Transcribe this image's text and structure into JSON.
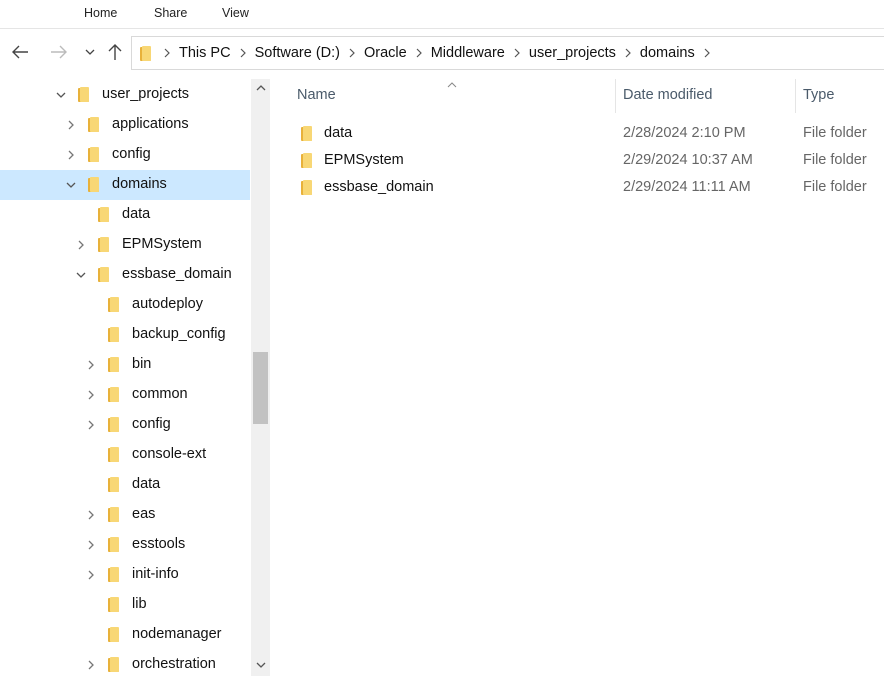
{
  "ribbon": {
    "tabs": [
      "Home",
      "Share",
      "View"
    ]
  },
  "nav": {
    "breadcrumb": [
      "This PC",
      "Software (D:)",
      "Oracle",
      "Middleware",
      "user_projects",
      "domains"
    ]
  },
  "tree": {
    "items": [
      {
        "label": "user_projects",
        "chevron": "down"
      },
      {
        "label": "applications",
        "chevron": "right"
      },
      {
        "label": "config",
        "chevron": "right"
      },
      {
        "label": "domains",
        "chevron": "down",
        "selected": true
      },
      {
        "label": "data",
        "chevron": ""
      },
      {
        "label": "EPMSystem",
        "chevron": "right"
      },
      {
        "label": "essbase_domain",
        "chevron": "down"
      },
      {
        "label": "autodeploy",
        "chevron": ""
      },
      {
        "label": "backup_config",
        "chevron": ""
      },
      {
        "label": "bin",
        "chevron": "right"
      },
      {
        "label": "common",
        "chevron": "right"
      },
      {
        "label": "config",
        "chevron": "right"
      },
      {
        "label": "console-ext",
        "chevron": ""
      },
      {
        "label": "data",
        "chevron": ""
      },
      {
        "label": "eas",
        "chevron": "right"
      },
      {
        "label": "esstools",
        "chevron": "right"
      },
      {
        "label": "init-info",
        "chevron": "right"
      },
      {
        "label": "lib",
        "chevron": ""
      },
      {
        "label": "nodemanager",
        "chevron": ""
      },
      {
        "label": "orchestration",
        "chevron": "right"
      }
    ]
  },
  "details": {
    "columns": {
      "name": "Name",
      "date": "Date modified",
      "type": "Type"
    },
    "rows": [
      {
        "name": "data",
        "date": "2/28/2024 2:10 PM",
        "type": "File folder"
      },
      {
        "name": "EPMSystem",
        "date": "2/29/2024 10:37 AM",
        "type": "File folder"
      },
      {
        "name": "essbase_domain",
        "date": "2/29/2024 11:11 AM",
        "type": "File folder"
      }
    ]
  },
  "colors": {
    "selection": "#cce8ff",
    "folder_front": "#f8d775",
    "folder_back": "#e8b13a"
  }
}
